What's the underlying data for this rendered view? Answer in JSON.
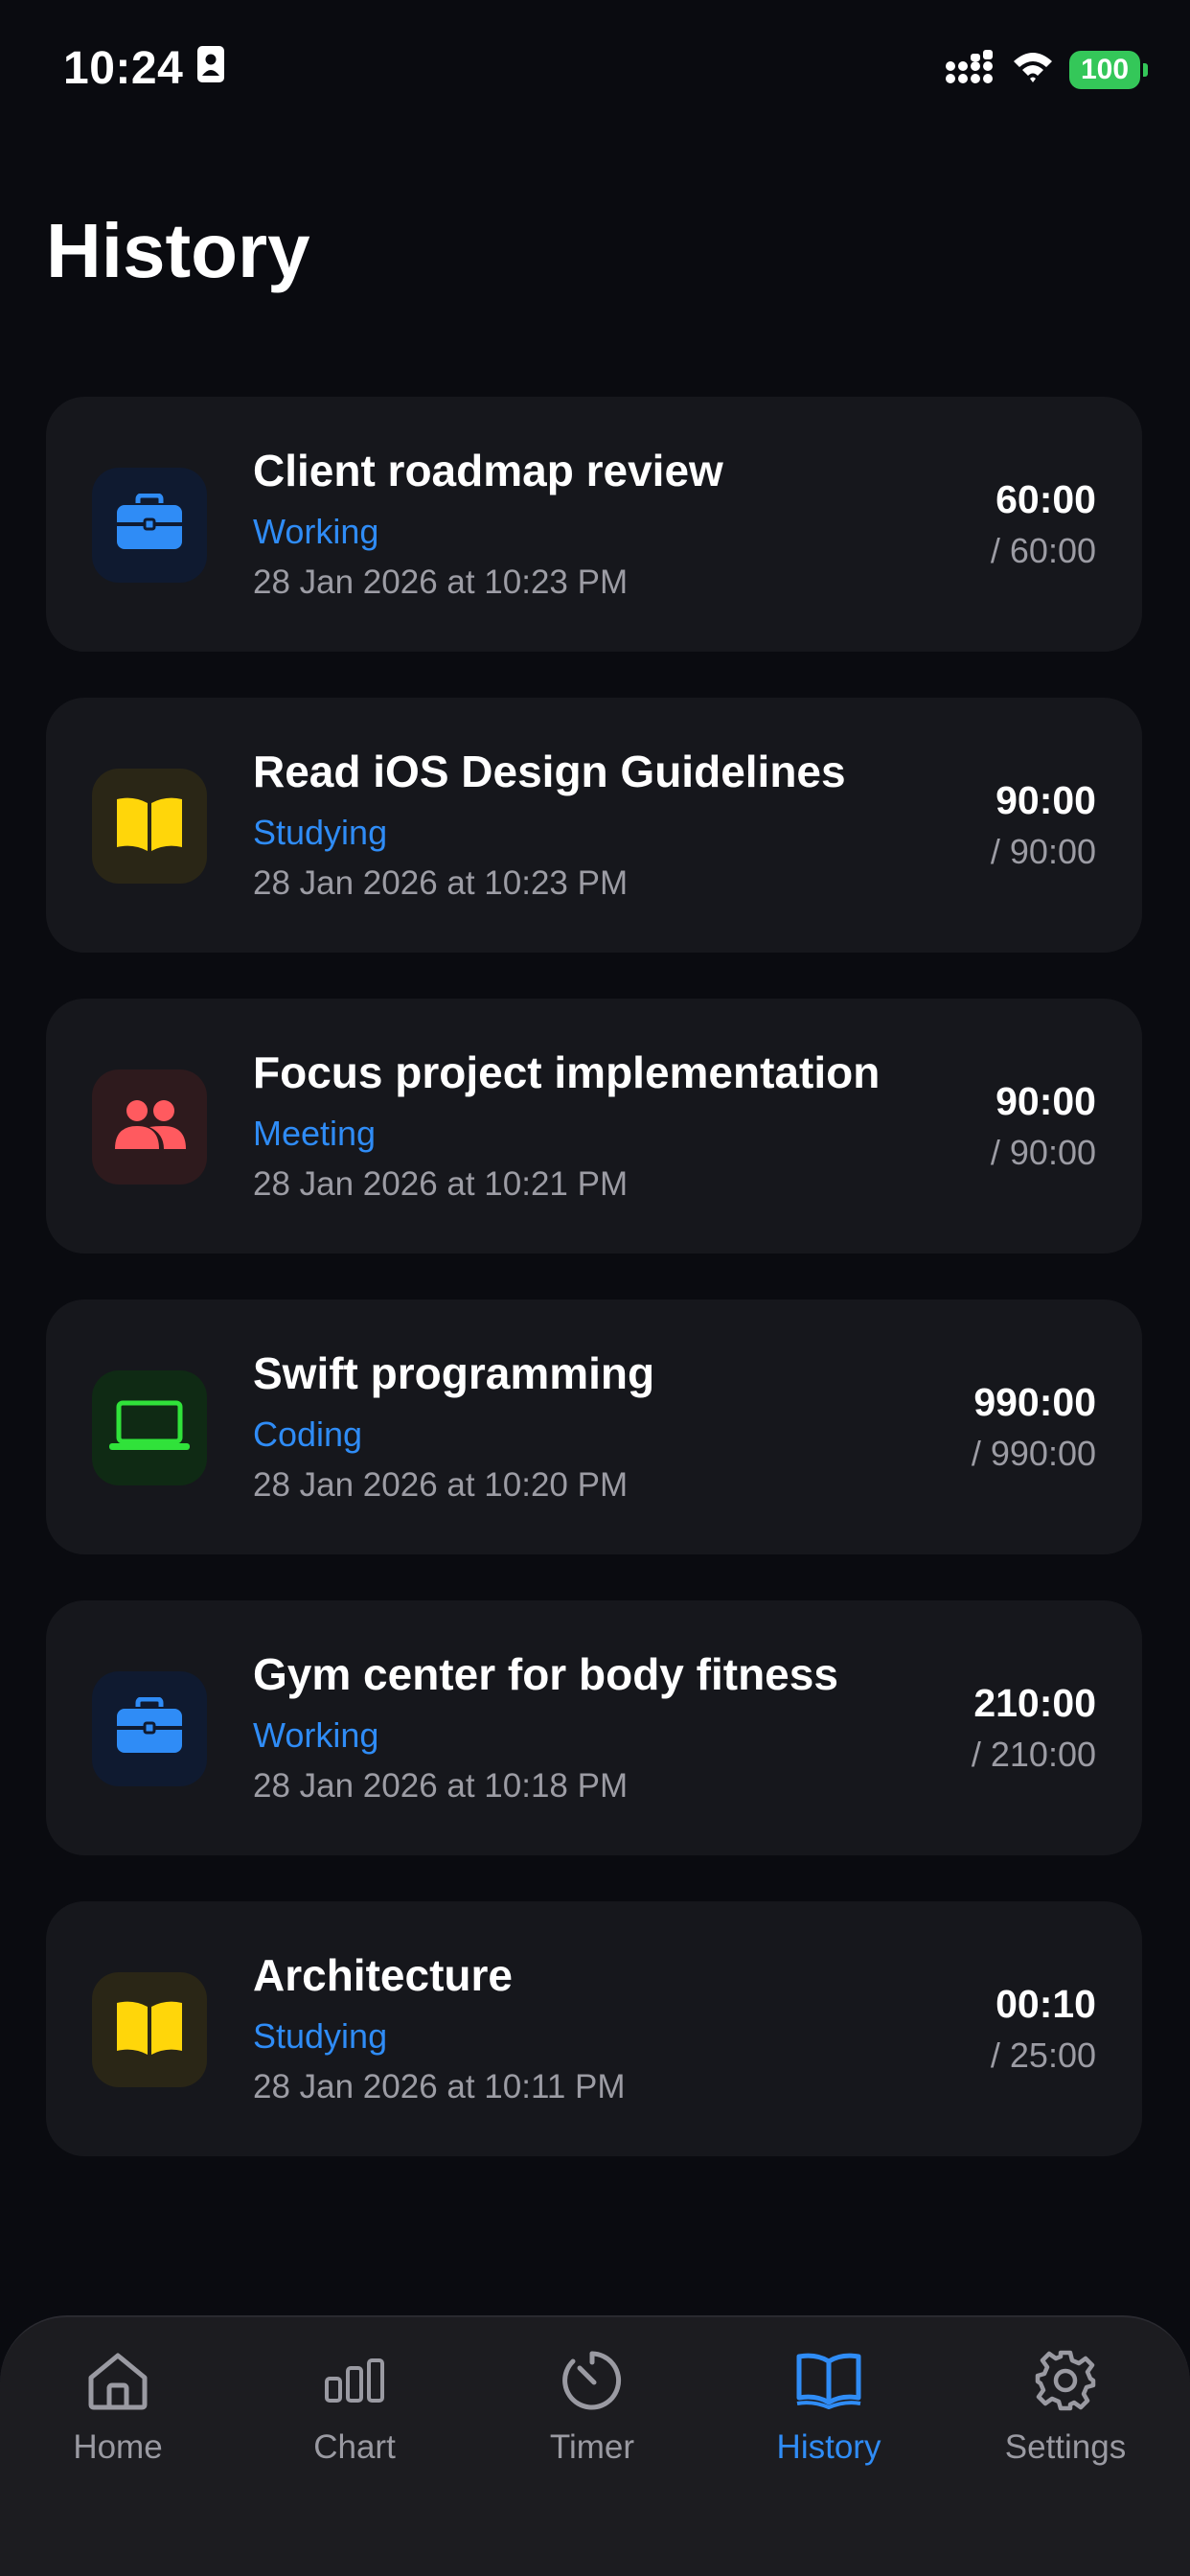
{
  "status_bar": {
    "time": "10:24",
    "battery": "100"
  },
  "header": {
    "title": "History"
  },
  "sessions": [
    {
      "title": "Client roadmap review",
      "category": "Working",
      "date": "28 Jan 2026 at 10:23 PM",
      "elapsed": "60:00",
      "total": "/ 60:00",
      "icon": "briefcase-icon",
      "icon_color": "#2f8cf6",
      "icon_bg": "#0f1a30"
    },
    {
      "title": "Read iOS Design Guidelines",
      "category": "Studying",
      "date": "28 Jan 2026 at 10:23 PM",
      "elapsed": "90:00",
      "total": "/ 90:00",
      "icon": "book-icon",
      "icon_color": "#ffd60a",
      "icon_bg": "#2a2616"
    },
    {
      "title": "Focus project implementation",
      "category": "Meeting",
      "date": "28 Jan 2026 at 10:21 PM",
      "elapsed": "90:00",
      "total": "/ 90:00",
      "icon": "people-icon",
      "icon_color": "#ff5a5f",
      "icon_bg": "#2e1a1d"
    },
    {
      "title": "Swift programming",
      "category": "Coding",
      "date": "28 Jan 2026 at 10:20 PM",
      "elapsed": "990:00",
      "total": "/ 990:00",
      "icon": "laptop-icon",
      "icon_color": "#30e23a",
      "icon_bg": "#0f2a14"
    },
    {
      "title": "Gym center for body fitness",
      "category": "Working",
      "date": "28 Jan 2026 at 10:18 PM",
      "elapsed": "210:00",
      "total": "/ 210:00",
      "icon": "briefcase-icon",
      "icon_color": "#2f8cf6",
      "icon_bg": "#0f1a30"
    },
    {
      "title": "Architecture",
      "category": "Studying",
      "date": "28 Jan 2026 at 10:11 PM",
      "elapsed": "00:10",
      "total": "/ 25:00",
      "icon": "book-icon",
      "icon_color": "#ffd60a",
      "icon_bg": "#2a2616"
    }
  ],
  "tab_bar": {
    "active": "History",
    "tabs": [
      {
        "label": "Home",
        "icon": "home-icon"
      },
      {
        "label": "Chart",
        "icon": "bar-chart-icon"
      },
      {
        "label": "Timer",
        "icon": "timer-icon"
      },
      {
        "label": "History",
        "icon": "book-open-icon"
      },
      {
        "label": "Settings",
        "icon": "gear-icon"
      }
    ]
  },
  "colors": {
    "background": "#0a0b10",
    "card": "#16171c",
    "accent": "#2f8cf6",
    "secondary_text": "#9c9ca4",
    "battery_green": "#34c759"
  }
}
